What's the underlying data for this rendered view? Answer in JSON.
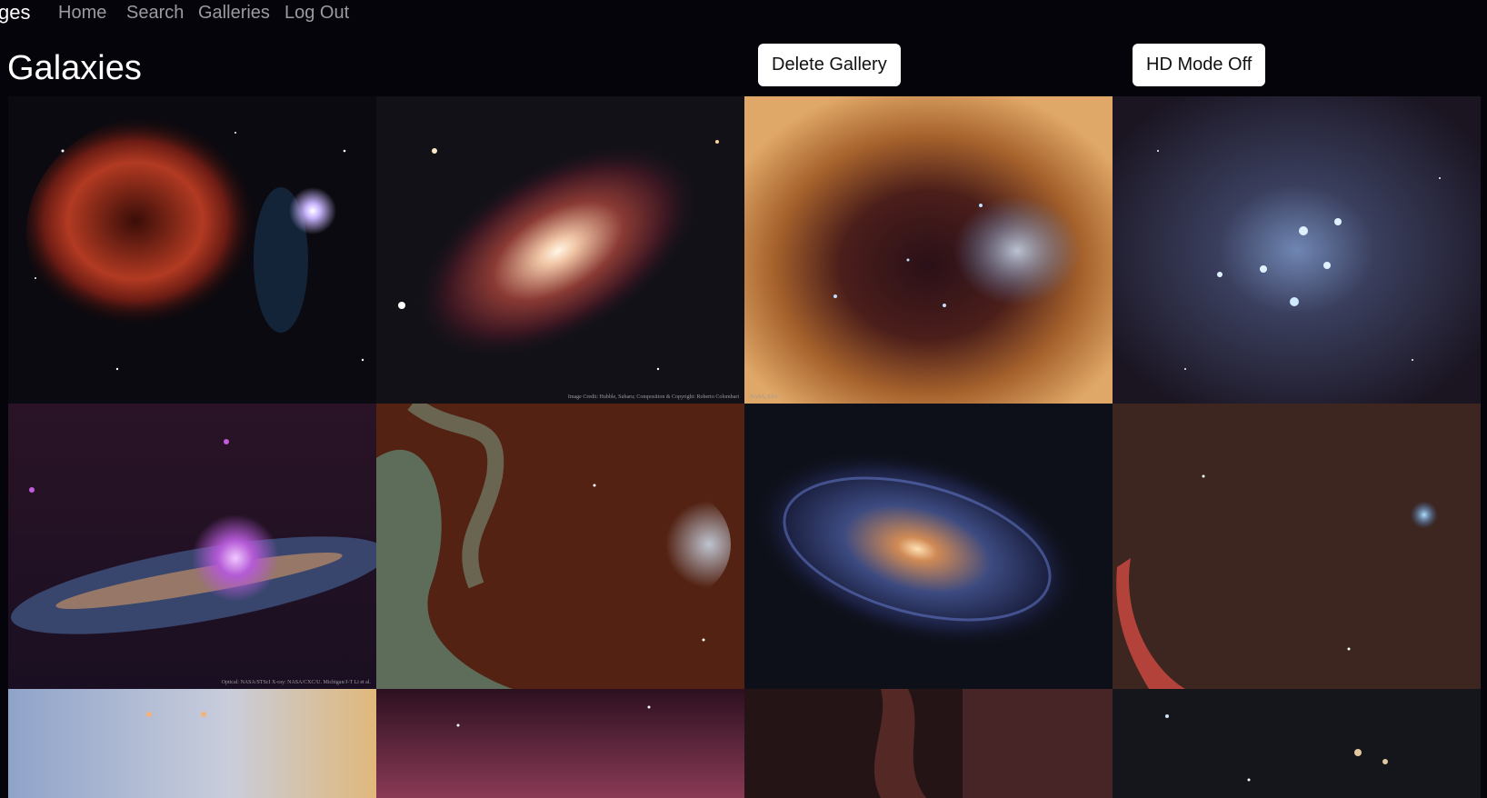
{
  "nav": {
    "brand": "ges",
    "links": [
      "Home",
      "Search",
      "Galleries",
      "Log Out"
    ]
  },
  "page": {
    "title": "Galaxies",
    "delete_button": "Delete Gallery",
    "hd_button": "HD Mode Off"
  },
  "images": [
    {
      "name": "jellyfish-nebula",
      "credit": ""
    },
    {
      "name": "spiral-galaxy-ngc2841",
      "credit": "Image Credit: Hubble, Subaru; Composition & Copyright: Roberto Colombari"
    },
    {
      "name": "star-cluster-r136",
      "credit": "NASA, ESA"
    },
    {
      "name": "pleiades-cluster",
      "credit": ""
    },
    {
      "name": "edge-on-galaxy-xray",
      "credit": "Optical: NASA/STScI  X-ray: NASA/CXC/U. Michigan/J-T Li et al."
    },
    {
      "name": "nebula-star-cluster",
      "credit": ""
    },
    {
      "name": "spiral-galaxy-m81",
      "credit": ""
    },
    {
      "name": "california-pleiades-wide",
      "credit": ""
    },
    {
      "name": "bright-nebula-top",
      "credit": ""
    },
    {
      "name": "red-nebula-top",
      "credit": ""
    },
    {
      "name": "dark-dust-top",
      "credit": ""
    },
    {
      "name": "galaxy-field-top",
      "credit": ""
    }
  ]
}
